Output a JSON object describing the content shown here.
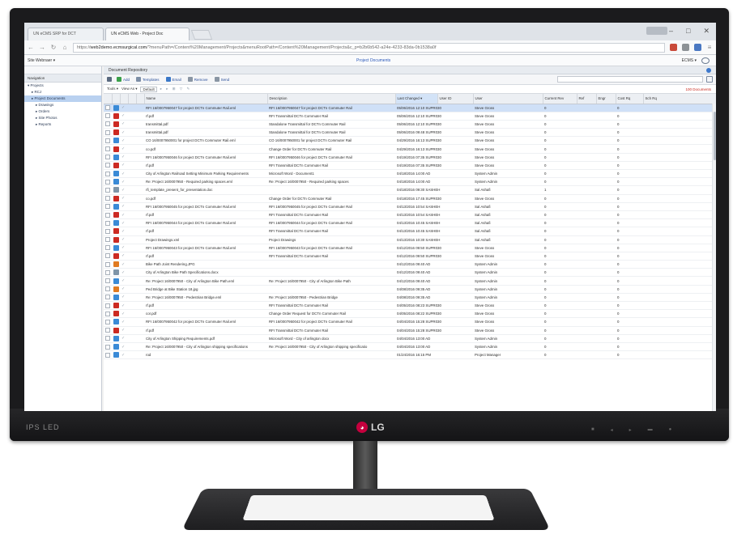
{
  "brand": {
    "logo_text": "LG",
    "panel_label": "IPS LED"
  },
  "browser": {
    "tabs": [
      {
        "label": "UN eCMS SRP for DCT"
      },
      {
        "label": "UN eCMS Web - Project Doc"
      }
    ],
    "url_prefix": "https://",
    "url_host": "web2demo.ecmsurgical.com",
    "url_rest": "/?menuPath=/Content%20Management/Projects&menuRootPath=/Content%20Management/Projects&c_p=b2b6b542-a24e-4233-83da-0b1538a0f"
  },
  "app": {
    "site_name": "Site Webnaer ▾",
    "page_link": "Project Documents",
    "user": "ECMS ▾"
  },
  "sidebar": {
    "header": "Navigation",
    "items": [
      {
        "label": "▾ Projects",
        "level": 0,
        "selected": false
      },
      {
        "label": "▸ RCJ",
        "level": 1,
        "selected": false
      },
      {
        "label": "▸ Project Documents",
        "level": 1,
        "selected": true
      },
      {
        "label": "▸ Drawings",
        "level": 2,
        "selected": false
      },
      {
        "label": "▸ Orders",
        "level": 2,
        "selected": false
      },
      {
        "label": "▸ Site Photos",
        "level": 2,
        "selected": false
      },
      {
        "label": "▸ Reports",
        "level": 2,
        "selected": false
      }
    ]
  },
  "main": {
    "title": "Document Repository",
    "toolbar": {
      "add": "Add",
      "templates": "Templates",
      "email": "Email",
      "remove": "Remove",
      "send": "Send"
    },
    "viewbar": {
      "tools": "Tools ▾",
      "view_as": "View As ▾",
      "view": "Default",
      "count": "100 Documents"
    },
    "columns": [
      "",
      "",
      "",
      "",
      "",
      "Name",
      "Description",
      "Last Changed ▾",
      "User ID",
      "User",
      "Current Rev",
      "Ref",
      "Engr",
      "Cost Rq",
      "Sch Rq"
    ],
    "rows": [
      {
        "icon": "blue",
        "name": "RFI 16/0007950047 for project DCTn Commuter Rail.eml",
        "desc": "RFI 16/0007950047 for project DCTn Commuter Rail",
        "date": "05/06/2016 12:10 SUPR030",
        "user": "Steve Gross",
        "rev": "0",
        "cost": "0",
        "sel": true
      },
      {
        "icon": "red",
        "name": "rf.pdf",
        "desc": "RFI Transmittal DCTn Commuter Rail",
        "date": "05/06/2016 12:10 SUPR030",
        "user": "Steve Gross",
        "rev": "0",
        "cost": "0",
        "sel": false
      },
      {
        "icon": "red",
        "name": "transmittal.pdf",
        "desc": "Standalone Transmittal for DCTn Commuter Rail",
        "date": "05/06/2016 12:10 SUPR030",
        "user": "Steve Gross",
        "rev": "0",
        "cost": "0",
        "sel": false
      },
      {
        "icon": "red",
        "name": "transmittal.pdf",
        "desc": "Standalone Transmittal for DCTn Commuter Rail",
        "date": "05/06/2016 09:48 SUPR030",
        "user": "Steve Gross",
        "rev": "0",
        "cost": "0",
        "sel": false
      },
      {
        "icon": "blue",
        "name": "CO 16/0007950001 for project DCTn Commuter Rail.eml",
        "desc": "CO 16/0007950001 for project DCTn Commuter Rail",
        "date": "04/29/2016 16:13 SUPR030",
        "user": "Steve Gross",
        "rev": "0",
        "cost": "0",
        "sel": false
      },
      {
        "icon": "red",
        "name": "co.pdf",
        "desc": "Change Order for DCTn Commuter Rail",
        "date": "04/29/2016 16:13 SUPR030",
        "user": "Steve Gross",
        "rev": "0",
        "cost": "0",
        "sel": false
      },
      {
        "icon": "blue",
        "name": "RFI 16/0007950046 for project DCTn Commuter Rail.eml",
        "desc": "RFI 16/0007950046 for project DCTn Commuter Rail",
        "date": "04/19/2016 07:35 SUPR030",
        "user": "Steve Gross",
        "rev": "0",
        "cost": "0",
        "sel": false
      },
      {
        "icon": "red",
        "name": "rf.pdf",
        "desc": "RFI Transmittal DCTn Commuter Rail",
        "date": "04/19/2016 07:35 SUPR030",
        "user": "Steve Gross",
        "rev": "0",
        "cost": "0",
        "sel": false
      },
      {
        "icon": "blue",
        "name": "City of Arlington Railroad Setting Minimum Parking Requirements",
        "desc": "Microsoft Word - Document1",
        "date": "04/18/2016 14:00 AD",
        "user": "System Admin",
        "rev": "0",
        "cost": "0",
        "sel": false
      },
      {
        "icon": "blue",
        "name": "Re: Project 16/0007950 - Required parking spaces.eml",
        "desc": "Re: Project 16/0007950 - Required parking spaces",
        "date": "04/18/2016 14:00 AD",
        "user": "System Admin",
        "rev": "0",
        "cost": "0",
        "sel": false
      },
      {
        "icon": "grey",
        "name": "rfi_template_present_for_presentation.doc",
        "desc": "",
        "date": "04/18/2016 09:30 SASHEH",
        "user": "Sal Ashafi",
        "rev": "1",
        "cost": "0",
        "sel": false
      },
      {
        "icon": "red",
        "name": "co.pdf",
        "desc": "Change Order for DCTn Commuter Rail",
        "date": "04/18/2016 17:45 SUPR030",
        "user": "Steve Gross",
        "rev": "0",
        "cost": "0",
        "sel": false
      },
      {
        "icon": "blue",
        "name": "RFI 16/0007950045 for project DCTn Commuter Rail.eml",
        "desc": "RFI 16/0007950045 for project DCTn Commuter Rail",
        "date": "04/13/2016 10:54 SASHEH",
        "user": "Sal Ashafi",
        "rev": "0",
        "cost": "0",
        "sel": false
      },
      {
        "icon": "red",
        "name": "rf.pdf",
        "desc": "RFI Transmittal DCTn Commuter Rail",
        "date": "04/13/2016 10:54 SASHEH",
        "user": "Sal Ashafi",
        "rev": "0",
        "cost": "0",
        "sel": false
      },
      {
        "icon": "blue",
        "name": "RFI 16/0007950044 for project DCTn Commuter Rail.eml",
        "desc": "RFI 16/0007950044 for project DCTn Commuter Rail",
        "date": "04/13/2016 10:45 SASHEH",
        "user": "Sal Ashafi",
        "rev": "0",
        "cost": "0",
        "sel": false
      },
      {
        "icon": "red",
        "name": "rf.pdf",
        "desc": "RFI Transmittal DCTn Commuter Rail",
        "date": "04/13/2016 10:45 SASHEH",
        "user": "Sal Ashafi",
        "rev": "0",
        "cost": "0",
        "sel": false
      },
      {
        "icon": "red",
        "name": "Project Drawings.xml",
        "desc": "Project Drawings",
        "date": "04/13/2016 10:30 SASHEH",
        "user": "Sal Ashafi",
        "rev": "0",
        "cost": "0",
        "sel": false
      },
      {
        "icon": "blue",
        "name": "RFI 16/0007950043 for project DCTn Commuter Rail.eml",
        "desc": "RFI 16/0007950043 for project DCTn Commuter Rail",
        "date": "04/12/2016 09:50 SUPR030",
        "user": "Steve Gross",
        "rev": "0",
        "cost": "0",
        "sel": false
      },
      {
        "icon": "red",
        "name": "rf.pdf",
        "desc": "RFI Transmittal DCTn Commuter Rail",
        "date": "04/12/2016 09:50 SUPR030",
        "user": "Steve Gross",
        "rev": "0",
        "cost": "0",
        "sel": false
      },
      {
        "icon": "orange",
        "name": "Bike Path Joint Rendering.JPG",
        "desc": "",
        "date": "04/12/2016 09:40 AD",
        "user": "System Admin",
        "rev": "0",
        "cost": "0",
        "sel": false
      },
      {
        "icon": "grey",
        "name": "City of Arlington Bike Path Specifications.docx",
        "desc": "",
        "date": "04/12/2016 09:40 AD",
        "user": "System Admin",
        "rev": "0",
        "cost": "0",
        "sel": false
      },
      {
        "icon": "blue",
        "name": "Re: Project 16/0007950 - City of Arlington Bike Path.eml",
        "desc": "Re: Project 16/0007950 - City of Arlington Bike Path",
        "date": "04/12/2016 09:40 AD",
        "user": "System Admin",
        "rev": "0",
        "cost": "0",
        "sel": false
      },
      {
        "icon": "orange",
        "name": "Ped Bridge at Bike Station 18.jpg",
        "desc": "",
        "date": "04/08/2016 09:35 AD",
        "user": "System Admin",
        "rev": "0",
        "cost": "0",
        "sel": false
      },
      {
        "icon": "blue",
        "name": "Re: Project 16/0007950 - Pedestrian Bridge.eml",
        "desc": "Re: Project 16/0007950 - Pedestrian Bridge",
        "date": "04/08/2016 09:35 AD",
        "user": "System Admin",
        "rev": "0",
        "cost": "0",
        "sel": false
      },
      {
        "icon": "red",
        "name": "rf.pdf",
        "desc": "RFI Transmittal DCTn Commuter Rail",
        "date": "04/05/2016 08:23 SUPR030",
        "user": "Steve Gross",
        "rev": "0",
        "cost": "0",
        "sel": false
      },
      {
        "icon": "red",
        "name": "cor.pdf",
        "desc": "Change Order Request for DCTn Commuter Rail",
        "date": "04/05/2016 08:22 SUPR030",
        "user": "Steve Gross",
        "rev": "0",
        "cost": "0",
        "sel": false
      },
      {
        "icon": "blue",
        "name": "RFI 16/0007950042 for project DCTn Commuter Rail.eml",
        "desc": "RFI 16/0007950042 for project DCTn Commuter Rail",
        "date": "04/04/2016 15:28 SUPR030",
        "user": "Steve Gross",
        "rev": "0",
        "cost": "0",
        "sel": false
      },
      {
        "icon": "red",
        "name": "rf.pdf",
        "desc": "RFI Transmittal DCTn Commuter Rail",
        "date": "04/04/2016 15:28 SUPR030",
        "user": "Steve Gross",
        "rev": "0",
        "cost": "0",
        "sel": false
      },
      {
        "icon": "blue",
        "name": "City of Arlington Shipping Requirements.pdf",
        "desc": "Microsoft Word - City of arlington docx",
        "date": "04/04/2016 13:00 AD",
        "user": "System Admin",
        "rev": "0",
        "cost": "0",
        "sel": false
      },
      {
        "icon": "blue",
        "name": "Re: Project 16/0007950 - City of Arlington shipping specifications",
        "desc": "Re: Project 16/0007950 - City of Arlington shipping specificatio",
        "date": "04/04/2016 13:00 AD",
        "user": "System Admin",
        "rev": "0",
        "cost": "0",
        "sel": false
      },
      {
        "icon": "blue",
        "name": "rod",
        "desc": "",
        "date": "01/24/2016 16:15 PM",
        "user": "Project Manager",
        "rev": "0",
        "cost": "0",
        "sel": false
      }
    ]
  },
  "colors": {
    "link_blue": "#2b58c0",
    "selection": "#cfe0f7",
    "count_red": "#c8281c",
    "lg_red": "#c5003e"
  }
}
